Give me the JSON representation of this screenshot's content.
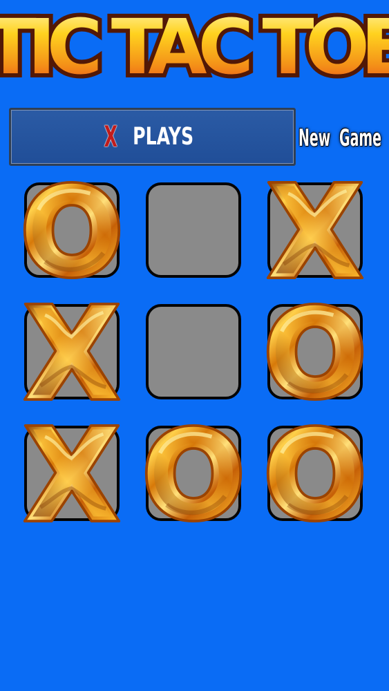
{
  "app": {
    "title": "TIC TAC TOE"
  },
  "status": {
    "player": "X",
    "message": "PLAYS"
  },
  "controls": {
    "new_game_label": "New Game"
  },
  "board": {
    "cells": [
      {
        "mark": "O"
      },
      {
        "mark": ""
      },
      {
        "mark": "X"
      },
      {
        "mark": "X"
      },
      {
        "mark": ""
      },
      {
        "mark": "O"
      },
      {
        "mark": "X"
      },
      {
        "mark": "O"
      },
      {
        "mark": "O"
      }
    ]
  },
  "colors": {
    "background": "#0a6cf5",
    "status_panel": "#2b5ba5",
    "cell": "#8a8a8a",
    "gold": "#f0a51a",
    "x_status": "#c01c1c"
  }
}
